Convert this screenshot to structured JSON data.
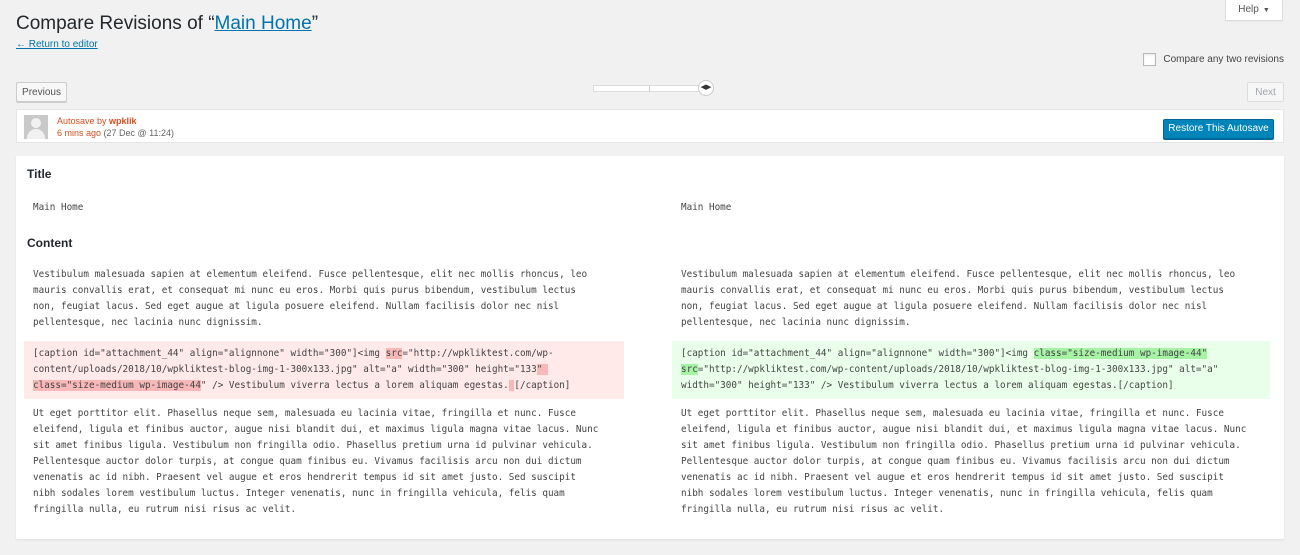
{
  "header": {
    "title_prefix": "Compare Revisions of “",
    "title_link": "Main Home",
    "title_suffix": "”",
    "return_link": "← Return to editor",
    "help_label": "Help",
    "help_icon": "triangle-down-icon",
    "compare_two_label": "Compare any two revisions",
    "compare_two_checked": false
  },
  "nav": {
    "previous_label": "Previous",
    "next_label": "Next",
    "slider_icon": "left-right-arrows-icon",
    "slider_position": 1.0
  },
  "revision_meta": {
    "type_label": "Autosave by ",
    "author": "wpklik",
    "relative_time": "6 mins ago",
    "date": " (27 Dec @ 11:24)",
    "restore_label": "Restore This Autosave",
    "accent_color": "#d54e21",
    "button_color": "#0085ba"
  },
  "diff": {
    "title_heading": "Title",
    "content_heading": "Content",
    "left": {
      "title_value": "Main Home",
      "para1": [
        "Vestibulum malesuada sapien at elementum eleifend. Fusce pellentesque, elit nec mollis rhoncus, leo",
        "mauris convallis erat, et consequat mi nunc eu eros. Morbi quis purus bibendum, vestibulum lectus",
        "non, feugiat lacus. Sed eget augue at ligula posuere eleifend. Nullam facilisis dolor nec nisl",
        "pellentesque, nec lacinia nunc dignissim."
      ],
      "caption": {
        "l1a": "[caption id=\"attachment_44\" align=\"alignnone\" width=\"300\"]<img ",
        "l1del": "src",
        "l1b": "=\"http://wpkliktest.com/wp-",
        "l2a": "content/uploads/2018/10/wpkliktest-blog-img-1-300x133.jpg\" alt=\"a\" width=\"300\" height=\"133",
        "l2del": "\" ",
        "l3del": "class=\"size-medium wp-image-44",
        "l3a": "\" /> Vestibulum viverra lectus a lorem aliquam egestas.",
        "l3del2": " ",
        "l3b": "[/caption]"
      },
      "para3": [
        "Ut eget porttitor elit. Phasellus neque sem, malesuada eu lacinia vitae, fringilla et nunc. Fusce",
        "eleifend, ligula et finibus auctor, augue nisi blandit dui, et maximus ligula magna vitae lacus. Nunc",
        "sit amet finibus ligula. Vestibulum non fringilla odio. Phasellus pretium urna id pulvinar vehicula.",
        "Pellentesque auctor dolor turpis, at congue quam finibus eu. Vivamus facilisis arcu non dui dictum",
        "venenatis ac id nibh. Praesent vel augue et eros hendrerit tempus id sit amet justo. Sed suscipit",
        "nibh sodales lorem vestibulum luctus. Integer venenatis, nunc in fringilla vehicula, felis quam",
        "fringilla nulla, eu rutrum nisi risus ac velit."
      ]
    },
    "right": {
      "title_value": "Main Home",
      "para1": [
        "Vestibulum malesuada sapien at elementum eleifend. Fusce pellentesque, elit nec mollis rhoncus, leo",
        "mauris convallis erat, et consequat mi nunc eu eros. Morbi quis purus bibendum, vestibulum lectus",
        "non, feugiat lacus. Sed eget augue at ligula posuere eleifend. Nullam facilisis dolor nec nisl",
        "pellentesque, nec lacinia nunc dignissim."
      ],
      "caption": {
        "l1a": "[caption id=\"attachment_44\" align=\"alignnone\" width=\"300\"]<img ",
        "l1ins": "class=\"size-medium wp-image-44\"",
        "l2ins": "src",
        "l2a": "=\"http://wpkliktest.com/wp-content/uploads/2018/10/wpkliktest-blog-img-1-300x133.jpg\" alt=\"a\"",
        "l3a": "width=\"300\" height=\"133\" /> Vestibulum viverra lectus a lorem aliquam egestas.[/caption]"
      },
      "para3": [
        "Ut eget porttitor elit. Phasellus neque sem, malesuada eu lacinia vitae, fringilla et nunc. Fusce",
        "eleifend, ligula et finibus auctor, augue nisi blandit dui, et maximus ligula magna vitae lacus. Nunc",
        "sit amet finibus ligula. Vestibulum non fringilla odio. Phasellus pretium urna id pulvinar vehicula.",
        "Pellentesque auctor dolor turpis, at congue quam finibus eu. Vivamus facilisis arcu non dui dictum",
        "venenatis ac id nibh. Praesent vel augue et eros hendrerit tempus id sit amet justo. Sed suscipit",
        "nibh sodales lorem vestibulum luctus. Integer venenatis, nunc in fringilla vehicula, felis quam",
        "fringilla nulla, eu rutrum nisi risus ac velit."
      ]
    }
  }
}
